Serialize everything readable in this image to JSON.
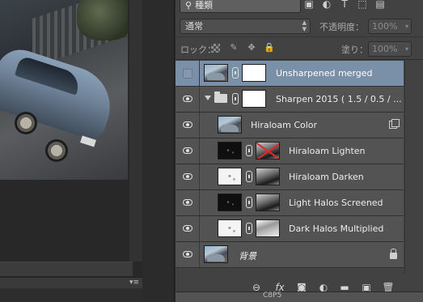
{
  "filter": {
    "kind_label": "種類",
    "icons": [
      "image-filter-icon",
      "adjustment-filter-icon",
      "type-filter-icon",
      "shape-filter-icon",
      "smart-object-filter-icon"
    ]
  },
  "blend": {
    "mode": "通常",
    "opacity_label": "不透明度：",
    "opacity_value": "100%"
  },
  "lock": {
    "label": "ロック：",
    "fill_label": "塗り：",
    "fill_value": "100%"
  },
  "layers": [
    {
      "name": "Unsharpened merged",
      "selected": true,
      "visible": false
    },
    {
      "name": "Sharpen 2015 ( 1.5 / 0.5 / ...",
      "group": true,
      "visible": true
    },
    {
      "name": "Hiraloam Color",
      "smart_object": true,
      "visible": true
    },
    {
      "name": "Hiraloam Lighten",
      "mask_disabled": true,
      "visible": true
    },
    {
      "name": "Hiraloam Darken",
      "visible": true
    },
    {
      "name": "Light Halos Screened",
      "visible": true
    },
    {
      "name": "Dark Halos Multiplied",
      "visible": true
    },
    {
      "name": "背景",
      "locked": true,
      "visible": true
    }
  ],
  "bottom_icons": [
    "link-layers-icon",
    "fx-icon",
    "add-mask-icon",
    "adjustment-layer-icon",
    "new-group-icon",
    "new-layer-icon",
    "delete-icon"
  ],
  "bottom_fx_label": "fx",
  "status_text": "C8P5"
}
